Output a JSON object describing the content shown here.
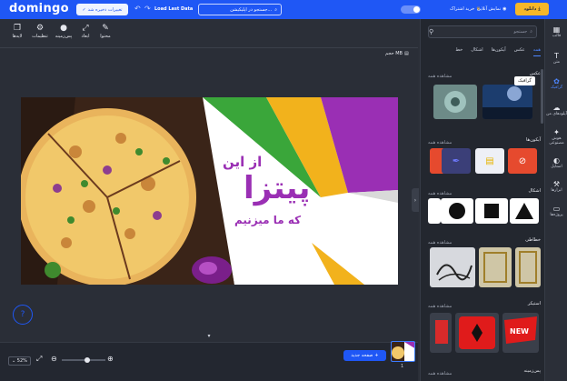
{
  "topbar": {
    "logo": "domingo",
    "save_status": "تغییرات ذخیره شد",
    "load_last": "Load Last Data",
    "search_placeholder": "جستجو در اپلیکیشن...",
    "toggle_label": "ملکی",
    "buy_subscription": "خرید اشتراک",
    "online_show": "نمایش آنلاین",
    "download": "دانلود"
  },
  "toolbar": {
    "content": "محتوا",
    "dimensions": "ابعاد",
    "background": "پس‌زمینه",
    "settings": "تنظیمات",
    "layers": "لایه‌ها"
  },
  "canvas": {
    "size_label": "حجم MB",
    "headline_top": "از این",
    "headline_main": "پیتزا",
    "headline_bottom": "که ما میزنیم"
  },
  "bottombar": {
    "zoom": "52%",
    "new_page": "صفحه جدید",
    "page_number": "1"
  },
  "panel": {
    "search_placeholder": "جستجو",
    "tabs": [
      "همه",
      "عکس",
      "آیکون‌ها",
      "اشکال",
      "خط"
    ],
    "view_all": "مشاهده همه",
    "sections": {
      "photos": "عکس",
      "icons": "آیکون‌ها",
      "shapes": "اشکال",
      "calligraphy": "خطاطی",
      "stickers": "استیکر",
      "backgrounds": "پس‌زمینه"
    },
    "tooltip": "گرافیک"
  },
  "rail": {
    "items": [
      "قالب",
      "متن",
      "گرافیک",
      "آپلودهای من",
      "هوش مصنوعی",
      "استایل",
      "ابزارها",
      "پروژه‌ها"
    ]
  },
  "colors": {
    "brand": "#1f57f5",
    "accent": "#f5b729",
    "purple": "#9a2fb4"
  }
}
